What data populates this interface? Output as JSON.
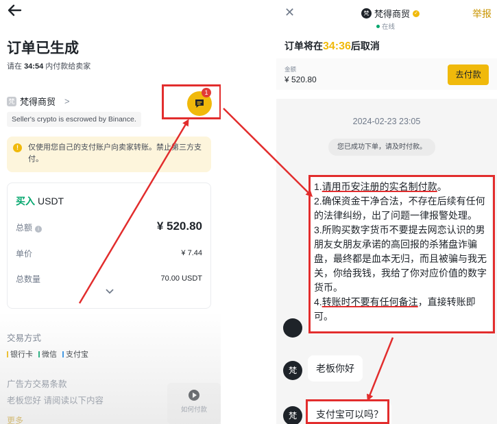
{
  "left": {
    "page_title": "订单已生成",
    "pay_hint_prefix": "请在",
    "pay_hint_time": "34:54",
    "pay_hint_suffix": "内付款给卖家",
    "merchant_logo": "梵",
    "merchant_name": "梵得商贸",
    "merchant_chevron": ">",
    "escrow_text": "Seller's crypto is escrowed by Binance.",
    "chat_badge_count": "1",
    "warning_icon": "!",
    "warning_text": "仅使用您自己的支付账户向卖家转账。禁止第三方支付。",
    "order_card": {
      "buy_label": "买入",
      "coin": "USDT",
      "total_label": "总额",
      "total_info_icon": "i",
      "total_value": "¥ 520.80",
      "price_label": "单价",
      "price_value": "¥ 7.44",
      "qty_label": "总数量",
      "qty_value": "70.00 USDT"
    },
    "payment_section_title": "交易方式",
    "payment_methods": [
      {
        "label": "银行卡",
        "color": "#f0b90b"
      },
      {
        "label": "微信",
        "color": "#03a66d"
      },
      {
        "label": "支付宝",
        "color": "#1e88e5"
      }
    ],
    "terms_section_title": "广告方交易条款",
    "terms_text": "老板您好 请阅读以下内容",
    "more_label": "更多",
    "how_pay_label": "如何付款"
  },
  "right": {
    "merchant_avatar": "梵",
    "merchant_name": "梵得商贸",
    "verified_icon": "✓",
    "online_label": "在线",
    "report_label": "举报",
    "cancel_prefix": "订单将在",
    "cancel_time": "34:36",
    "cancel_suffix": "后取消",
    "amount_label": "金额",
    "amount_value": "¥ 520.80",
    "pay_button": "去付款",
    "chat_timestamp": "2024-02-23 23:05",
    "system_message": "您已成功下单，请及时付款。",
    "message_lines": [
      {
        "prefix": "1.",
        "underlined": "请用币安注册的实名制付款",
        "rest": "。"
      },
      {
        "prefix": "",
        "underlined": "",
        "rest": "2.确保资金干净合法，不存在后续有任何的法律纠纷，出了问题一律报警处理。"
      },
      {
        "prefix": "",
        "underlined": "",
        "rest": "3.所购买数字货币不要提去网恋认识的男朋友女朋友承诺的高回报的杀猪盘诈骗盘，最终都是血本无归，而且被骗与我无关，你给我钱，我给了你对应价值的数字货币。"
      },
      {
        "prefix": "4.",
        "underlined": "转账时不要有任何备注",
        "rest": "，直接转账即可。"
      }
    ],
    "avatar_letter": "梵",
    "msg_greeting": "老板你好",
    "msg_question": "支付宝可以吗？"
  },
  "colors": {
    "accent_yellow": "#f0b90b",
    "buy_green": "#03a66d",
    "highlight_red": "#e22d2d"
  }
}
